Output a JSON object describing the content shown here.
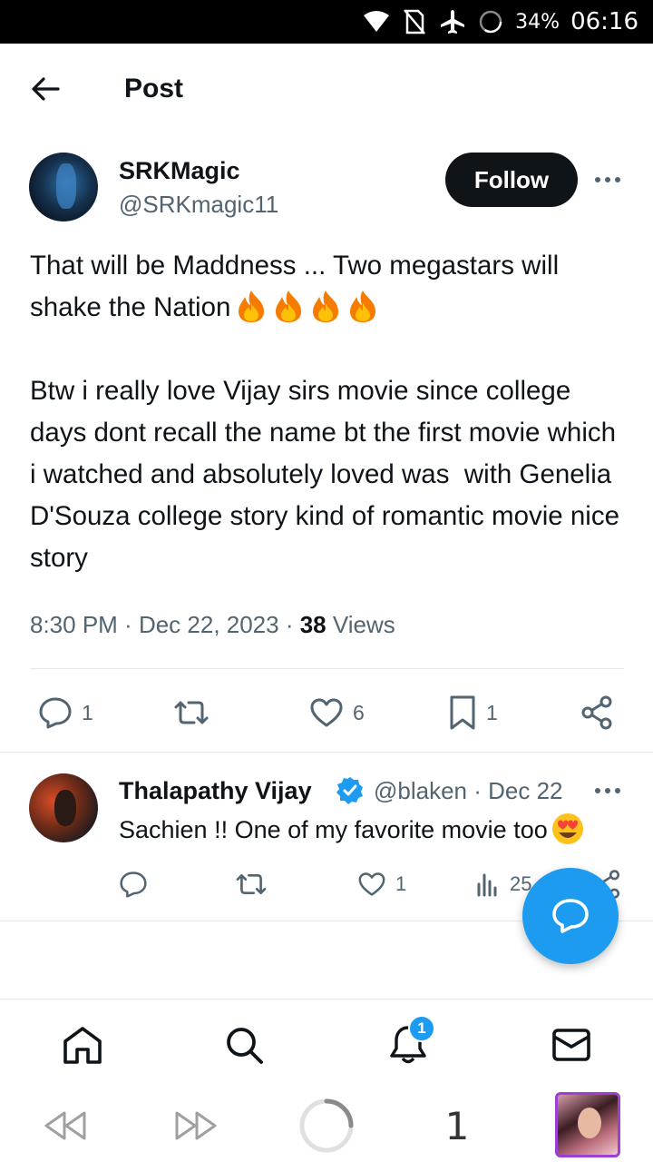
{
  "status_bar": {
    "battery": "34%",
    "time": "06:16"
  },
  "header": {
    "title": "Post"
  },
  "post": {
    "author_name": "SRKMagic",
    "author_handle": "@SRKmagic11",
    "follow_label": "Follow",
    "paragraph1": "That will be Maddness ... Two megastars will shake the Nation",
    "paragraph2": "Btw i really love Vijay sirs movie since college days dont recall the name bt the first movie which i watched and absolutely loved was  with Genelia D'Souza college story kind of romantic movie nice story",
    "time": "8:30 PM",
    "date": "Dec 22, 2023",
    "views_count": "38",
    "views_label": "Views",
    "stats": {
      "replies": "1",
      "reposts": "",
      "likes": "6",
      "bookmarks": "1"
    }
  },
  "reply": {
    "name": "Thalapathy Vijay",
    "handle": "@blaken",
    "date": "Dec 22",
    "text": "Sachien !! One of my favorite movie too",
    "stats": {
      "replies": "",
      "reposts": "",
      "likes": "1",
      "views": "25"
    }
  },
  "bottom_nav": {
    "notification_badge": "1"
  },
  "browser": {
    "tab_count": "1"
  },
  "colors": {
    "accent": "#1d9bf0",
    "text": "#0f1419",
    "secondary": "#536471"
  },
  "icons": [
    "wifi-icon",
    "no-sim-icon",
    "airplane-icon",
    "battery-icon",
    "back-arrow-icon",
    "more-icon",
    "fire-emoji",
    "reply-icon",
    "repost-icon",
    "like-icon",
    "bookmark-icon",
    "share-icon",
    "views-icon",
    "verified-icon",
    "heart-eyes-emoji",
    "compose-reply-icon",
    "home-icon",
    "search-icon",
    "notifications-icon",
    "messages-icon",
    "rewind-icon",
    "forward-icon",
    "loading-icon"
  ]
}
